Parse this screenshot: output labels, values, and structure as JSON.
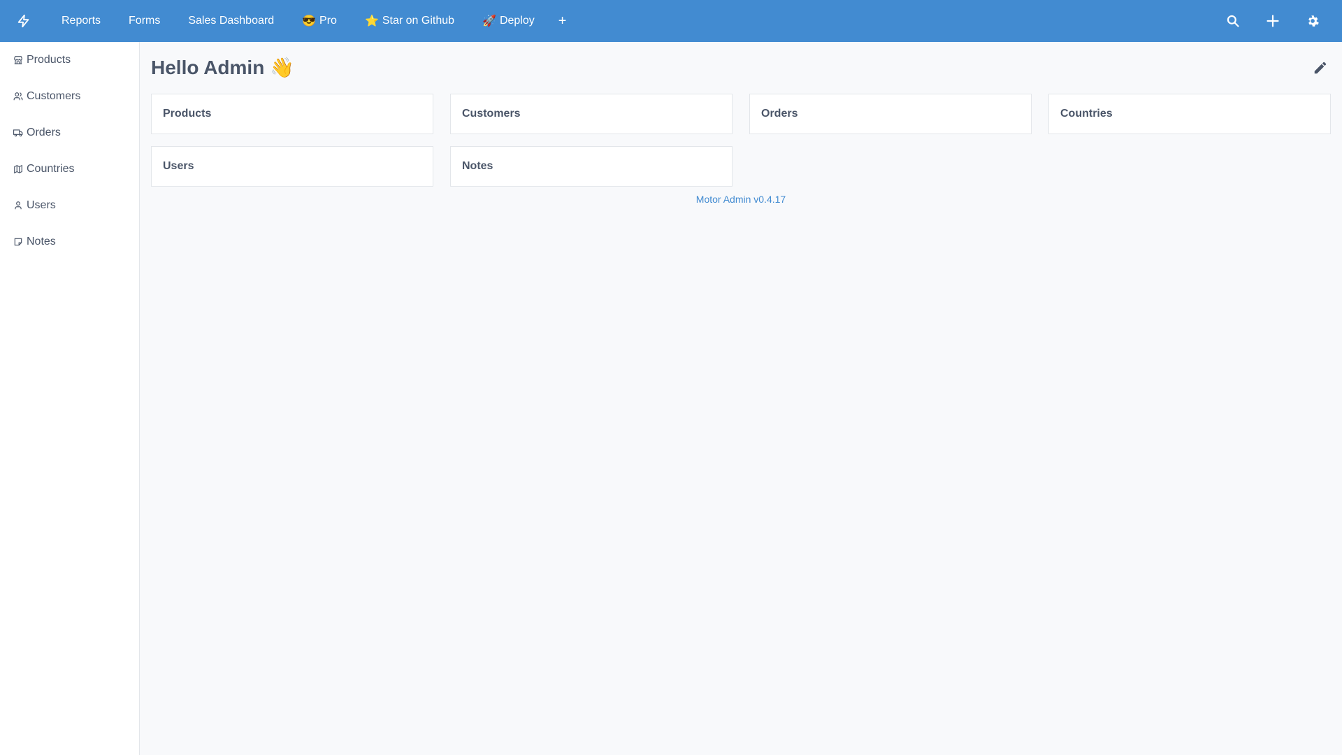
{
  "topbar": {
    "nav_items": [
      {
        "label": "Reports"
      },
      {
        "label": "Forms"
      },
      {
        "label": "Sales Dashboard"
      },
      {
        "emoji": "😎",
        "label": "Pro"
      },
      {
        "emoji": "⭐",
        "label": "Star on Github"
      },
      {
        "emoji": "🚀",
        "label": "Deploy"
      }
    ],
    "add_label": "+"
  },
  "sidebar": {
    "items": [
      {
        "label": "Products",
        "icon": "building-store-icon"
      },
      {
        "label": "Customers",
        "icon": "users-icon"
      },
      {
        "label": "Orders",
        "icon": "truck-icon"
      },
      {
        "label": "Countries",
        "icon": "map-icon"
      },
      {
        "label": "Users",
        "icon": "user-icon"
      },
      {
        "label": "Notes",
        "icon": "note-icon"
      }
    ]
  },
  "main": {
    "title": "Hello Admin 👋",
    "cards": [
      {
        "label": "Products"
      },
      {
        "label": "Customers"
      },
      {
        "label": "Orders"
      },
      {
        "label": "Countries"
      },
      {
        "label": "Users"
      },
      {
        "label": "Notes"
      }
    ],
    "footer": "Motor Admin v0.4.17"
  },
  "colors": {
    "topbar": "#428bd1",
    "background": "#f8f9fb",
    "text": "#4a5568",
    "link": "#428bd1"
  }
}
